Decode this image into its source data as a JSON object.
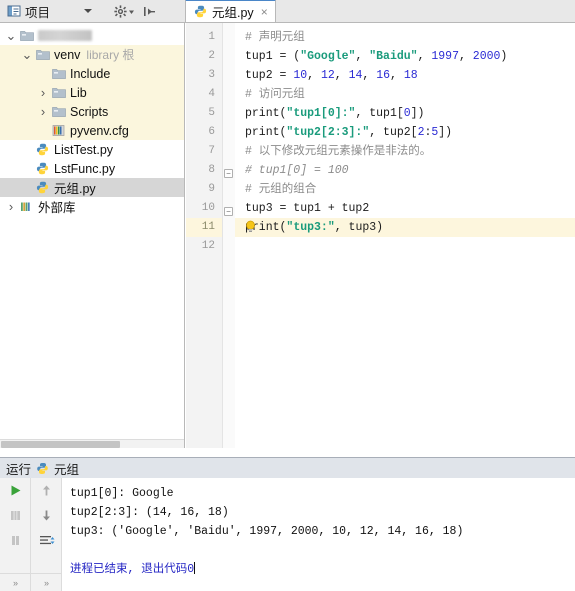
{
  "topbar": {
    "project_label": "项目",
    "project_icon": "project-panel-icon",
    "dropdown_icon": "chevron-down-icon",
    "settings_icon": "gear-icon",
    "settings_dropdown_icon": "chevron-down-small-icon",
    "collapse_icon": "hide-panel-icon"
  },
  "tabs": [
    {
      "title": "元组.py",
      "icon": "python-file-icon",
      "close": "×",
      "active": true
    }
  ],
  "project_tree": [
    {
      "indent": 0,
      "arrow": "v",
      "icon": "folder-icon",
      "label": "",
      "redacted": true,
      "dim": "",
      "selected": false,
      "highlight": false
    },
    {
      "indent": 1,
      "arrow": "v",
      "icon": "folder-icon",
      "label": "venv",
      "dim": "library 根",
      "selected": false,
      "highlight": true
    },
    {
      "indent": 2,
      "arrow": "",
      "icon": "folder-icon",
      "label": "Include",
      "dim": "",
      "selected": false,
      "highlight": true
    },
    {
      "indent": 2,
      "arrow": ">",
      "icon": "folder-icon",
      "label": "Lib",
      "dim": "",
      "selected": false,
      "highlight": true
    },
    {
      "indent": 2,
      "arrow": ">",
      "icon": "folder-icon",
      "label": "Scripts",
      "dim": "",
      "selected": false,
      "highlight": true
    },
    {
      "indent": 2,
      "arrow": "",
      "icon": "config-file-icon",
      "label": "pyvenv.cfg",
      "dim": "",
      "selected": false,
      "highlight": true
    },
    {
      "indent": 1,
      "arrow": "",
      "icon": "python-file-icon",
      "label": "ListTest.py",
      "dim": "",
      "selected": false,
      "highlight": false
    },
    {
      "indent": 1,
      "arrow": "",
      "icon": "python-file-icon",
      "label": "LstFunc.py",
      "dim": "",
      "selected": false,
      "highlight": false
    },
    {
      "indent": 1,
      "arrow": "",
      "icon": "python-file-icon",
      "label": "元组.py",
      "dim": "",
      "selected": true,
      "highlight": false
    },
    {
      "indent": 0,
      "arrow": ">",
      "icon": "external-library-icon",
      "label": "外部库",
      "dim": "",
      "selected": false,
      "highlight": false
    }
  ],
  "editor": {
    "line_numbers": [
      "1",
      "2",
      "3",
      "4",
      "5",
      "6",
      "7",
      "8",
      "9",
      "10",
      "11",
      "12"
    ],
    "current_line": 11,
    "fold_lines": [
      7,
      9
    ],
    "bulb_icon": "intention-bulb-icon",
    "lines": [
      {
        "n": 1,
        "tokens": [
          {
            "t": "comment",
            "s": "# 声明元组"
          }
        ]
      },
      {
        "n": 2,
        "tokens": [
          {
            "t": "plain",
            "s": "tup1 = ("
          },
          {
            "t": "str",
            "s": "\"Google\""
          },
          {
            "t": "plain",
            "s": ", "
          },
          {
            "t": "str",
            "s": "\"Baidu\""
          },
          {
            "t": "plain",
            "s": ", "
          },
          {
            "t": "num",
            "s": "1997"
          },
          {
            "t": "plain",
            "s": ", "
          },
          {
            "t": "num",
            "s": "2000"
          },
          {
            "t": "plain",
            "s": ")"
          }
        ]
      },
      {
        "n": 3,
        "tokens": [
          {
            "t": "plain",
            "s": "tup2 = "
          },
          {
            "t": "num",
            "s": "10"
          },
          {
            "t": "plain",
            "s": ", "
          },
          {
            "t": "num",
            "s": "12"
          },
          {
            "t": "plain",
            "s": ", "
          },
          {
            "t": "num",
            "s": "14"
          },
          {
            "t": "plain",
            "s": ", "
          },
          {
            "t": "num",
            "s": "16"
          },
          {
            "t": "plain",
            "s": ", "
          },
          {
            "t": "num",
            "s": "18"
          }
        ]
      },
      {
        "n": 4,
        "tokens": [
          {
            "t": "comment",
            "s": "# 访问元组"
          }
        ]
      },
      {
        "n": 5,
        "tokens": [
          {
            "t": "plain",
            "s": "print("
          },
          {
            "t": "str",
            "s": "\"tup1[0]:\""
          },
          {
            "t": "plain",
            "s": ", tup1["
          },
          {
            "t": "num",
            "s": "0"
          },
          {
            "t": "plain",
            "s": "])"
          }
        ]
      },
      {
        "n": 6,
        "tokens": [
          {
            "t": "plain",
            "s": "print("
          },
          {
            "t": "str",
            "s": "\"tup2[2:3]:\""
          },
          {
            "t": "plain",
            "s": ", tup2["
          },
          {
            "t": "num",
            "s": "2"
          },
          {
            "t": "plain",
            "s": ":"
          },
          {
            "t": "num",
            "s": "5"
          },
          {
            "t": "plain",
            "s": "])"
          }
        ]
      },
      {
        "n": 7,
        "tokens": [
          {
            "t": "comment",
            "s": "# 以下修改元组元素操作是非法的。"
          }
        ]
      },
      {
        "n": 8,
        "tokens": [
          {
            "t": "comment-i",
            "s": "# tup1[0] = 100"
          }
        ]
      },
      {
        "n": 9,
        "tokens": [
          {
            "t": "comment",
            "s": "# 元组的组合"
          }
        ]
      },
      {
        "n": 10,
        "tokens": [
          {
            "t": "plain",
            "s": "tup3 = tup1 + tup2"
          }
        ]
      },
      {
        "n": 11,
        "tokens": [
          {
            "t": "plain",
            "s": "print("
          },
          {
            "t": "str",
            "s": "\"tup3:\""
          },
          {
            "t": "plain",
            "s": ", tup3)"
          }
        ]
      },
      {
        "n": 12,
        "tokens": [
          {
            "t": "plain",
            "s": ""
          }
        ]
      }
    ]
  },
  "run_panel": {
    "header_label": "运行",
    "header_icon": "python-run-config-icon",
    "config_name": "元组",
    "tools_left": [
      {
        "name": "run-button",
        "glyph": "▶",
        "color": "#3aa33a"
      },
      {
        "name": "stop-button",
        "glyph": "■",
        "color": "#bdbdbd"
      },
      {
        "name": "pause-button",
        "glyph": "❙❙",
        "color": "#bdbdbd"
      },
      {
        "name": "more-tools-left",
        "glyph": "»",
        "color": "#9a9a9a"
      }
    ],
    "tools_right": [
      {
        "name": "scroll-up-button",
        "glyph": "↑",
        "color": "#9a9a9a"
      },
      {
        "name": "scroll-down-button",
        "glyph": "↓",
        "color": "#9a9a9a"
      },
      {
        "name": "soft-wrap-button",
        "glyph": "⇌",
        "color": "#4a86c8"
      },
      {
        "name": "more-tools-right",
        "glyph": "»",
        "color": "#9a9a9a"
      }
    ],
    "console_lines": [
      {
        "text": "tup1[0]: Google",
        "style": "normal"
      },
      {
        "text": "tup2[2:3]: (14, 16, 18)",
        "style": "normal"
      },
      {
        "text": "tup3: ('Google', 'Baidu', 1997, 2000, 10, 12, 14, 16, 18)",
        "style": "normal"
      },
      {
        "text": "",
        "style": "normal"
      },
      {
        "text": "进程已结束, 退出代码0",
        "style": "exit"
      }
    ]
  },
  "colors": {
    "string": "#1a9b7c",
    "number": "#2b2bd4",
    "comment": "#8c8c8c",
    "current_line_bg": "#fdf6dd",
    "library_highlight_bg": "#fbf6dd",
    "selection_bg": "#d6d6d6",
    "tab_active_border": "#4a86c8",
    "run_green": "#3aa33a",
    "exit_text": "#2526c4"
  }
}
